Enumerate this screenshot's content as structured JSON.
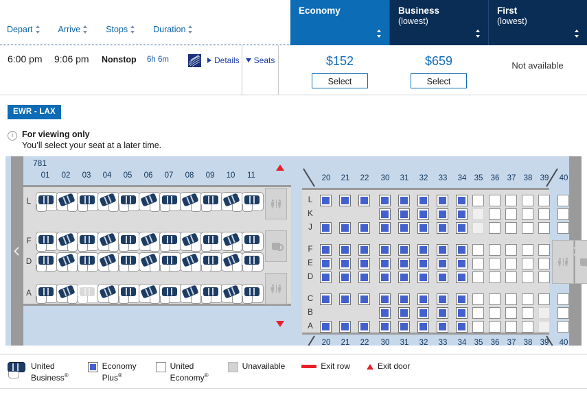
{
  "sorts": [
    {
      "label": "Depart",
      "icon": "sort-updown-icon"
    },
    {
      "label": "Arrive",
      "icon": "sort-updown-icon"
    },
    {
      "label": "Stops",
      "icon": "sort-updown-icon"
    },
    {
      "label": "Duration",
      "icon": "sort-updown-icon"
    }
  ],
  "fare_columns": [
    {
      "title": "Economy",
      "subtitle": "",
      "accent": "#0c6cb5"
    },
    {
      "title": "Business",
      "subtitle": "(lowest)",
      "accent": "#0a2d56"
    },
    {
      "title": "First",
      "subtitle": "(lowest)",
      "accent": "#0a2d56"
    }
  ],
  "flight": {
    "depart": "6:00 pm",
    "arrive": "9:06 pm",
    "stops": "Nonstop",
    "duration": "6h 6m",
    "details_label": "Details",
    "seats_label": "Seats",
    "airline_logo": "united-logo-icon"
  },
  "fares": [
    {
      "price": "$152",
      "select_label": "Select",
      "available": true
    },
    {
      "price": "$659",
      "select_label": "Select",
      "available": true
    },
    {
      "price": "",
      "select_label": "",
      "available": false,
      "unavailable_label": "Not available"
    }
  ],
  "seatmap": {
    "route_badge": "EWR - LAX",
    "notice_title": "For viewing only",
    "notice_text": "You’ll select your seat at a later time.",
    "aircraft": "781",
    "forward": {
      "columns": [
        "01",
        "02",
        "03",
        "04",
        "05",
        "06",
        "07",
        "08",
        "09",
        "10",
        "11"
      ],
      "rows": [
        {
          "letter": "L",
          "seats": [
            "business",
            "business",
            "business",
            "business",
            "business",
            "business",
            "business",
            "business",
            "business",
            "business",
            "business"
          ]
        },
        {
          "letter": "F",
          "seats": [
            "business",
            "business",
            "business",
            "business",
            "business",
            "business",
            "business",
            "business",
            "business",
            "business",
            "business"
          ]
        },
        {
          "letter": "D",
          "seats": [
            "business",
            "business",
            "business",
            "business",
            "business",
            "business",
            "business",
            "business",
            "business",
            "business",
            "business"
          ]
        },
        {
          "letter": "A",
          "seats": [
            "business",
            "business",
            "unavailable",
            "business",
            "business",
            "business",
            "business",
            "business",
            "business",
            "business",
            "business"
          ]
        }
      ]
    },
    "aft": {
      "columns": [
        "20",
        "21",
        "22",
        "30",
        "31",
        "32",
        "33",
        "34",
        "35",
        "36",
        "37",
        "38",
        "39",
        "40"
      ],
      "rows": [
        {
          "letter": "L",
          "seats": [
            "plus",
            "plus",
            "plus",
            "plus",
            "plus",
            "plus",
            "plus",
            "plus",
            "economy",
            "economy",
            "economy",
            "economy",
            "economy",
            "economy"
          ]
        },
        {
          "letter": "K",
          "seats": [
            "none",
            "none",
            "none",
            "plus",
            "plus",
            "plus",
            "plus",
            "plus",
            "unavailable",
            "economy",
            "economy",
            "economy",
            "economy",
            "economy"
          ]
        },
        {
          "letter": "J",
          "seats": [
            "plus",
            "plus",
            "plus",
            "plus",
            "plus",
            "plus",
            "plus",
            "plus",
            "unavailable",
            "economy",
            "economy",
            "economy",
            "economy",
            "economy"
          ]
        },
        {
          "letter": "F",
          "seats": [
            "plus",
            "plus",
            "plus",
            "plus",
            "plus",
            "plus",
            "plus",
            "plus",
            "economy",
            "economy",
            "economy",
            "economy",
            "economy",
            "none"
          ]
        },
        {
          "letter": "E",
          "seats": [
            "plus",
            "plus",
            "plus",
            "plus",
            "plus",
            "plus",
            "plus",
            "plus",
            "economy",
            "economy",
            "economy",
            "economy",
            "economy",
            "none"
          ]
        },
        {
          "letter": "D",
          "seats": [
            "plus",
            "plus",
            "plus",
            "plus",
            "plus",
            "plus",
            "plus",
            "plus",
            "economy",
            "economy",
            "economy",
            "economy",
            "economy",
            "none"
          ]
        },
        {
          "letter": "C",
          "seats": [
            "plus",
            "plus",
            "plus",
            "plus",
            "plus",
            "plus",
            "plus",
            "plus",
            "economy",
            "economy",
            "economy",
            "economy",
            "economy",
            "economy"
          ]
        },
        {
          "letter": "B",
          "seats": [
            "none",
            "none",
            "none",
            "plus",
            "plus",
            "plus",
            "plus",
            "plus",
            "economy",
            "economy",
            "economy",
            "economy",
            "unavailable",
            "economy"
          ]
        },
        {
          "letter": "A",
          "seats": [
            "plus",
            "plus",
            "plus",
            "plus",
            "plus",
            "plus",
            "plus",
            "plus",
            "economy",
            "economy",
            "economy",
            "economy",
            "unavailable",
            "economy"
          ]
        }
      ]
    },
    "nav_prev_icon": "chevron-left-icon",
    "nav_next_icon": "chevron-right-icon"
  },
  "legend": [
    {
      "label_line1": "United",
      "label_line2": "Business",
      "mark": "business-pod",
      "reg": true
    },
    {
      "label_line1": "Economy",
      "label_line2": "Plus",
      "mark": "plus-square",
      "reg": true
    },
    {
      "label_line1": "United",
      "label_line2": "Economy",
      "mark": "economy-square",
      "reg": true
    },
    {
      "label_line1": "Unavailable",
      "label_line2": "",
      "mark": "unavailable-square",
      "reg": false
    },
    {
      "label_line1": "Exit row",
      "label_line2": "",
      "mark": "exit-row-bar",
      "reg": false
    },
    {
      "label_line1": "Exit door",
      "label_line2": "",
      "mark": "exit-door-triangle",
      "reg": false
    }
  ]
}
